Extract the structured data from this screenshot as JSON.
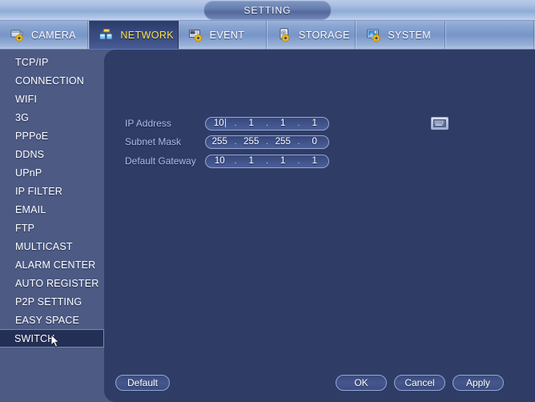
{
  "window": {
    "title": "SETTING"
  },
  "tabs": [
    {
      "label": "CAMERA",
      "icon": "camera-gear-icon",
      "active": false
    },
    {
      "label": "NETWORK",
      "icon": "network-gear-icon",
      "active": true
    },
    {
      "label": "EVENT",
      "icon": "event-gear-icon",
      "active": false
    },
    {
      "label": "STORAGE",
      "icon": "storage-gear-icon",
      "active": false
    },
    {
      "label": "SYSTEM",
      "icon": "system-gear-icon",
      "active": false
    }
  ],
  "sidebar": {
    "items": [
      {
        "label": "TCP/IP",
        "selected": false
      },
      {
        "label": "CONNECTION",
        "selected": false
      },
      {
        "label": "WIFI",
        "selected": false
      },
      {
        "label": "3G",
        "selected": false
      },
      {
        "label": "PPPoE",
        "selected": false
      },
      {
        "label": "DDNS",
        "selected": false
      },
      {
        "label": "UPnP",
        "selected": false
      },
      {
        "label": "IP FILTER",
        "selected": false
      },
      {
        "label": "EMAIL",
        "selected": false
      },
      {
        "label": "FTP",
        "selected": false
      },
      {
        "label": "MULTICAST",
        "selected": false
      },
      {
        "label": "ALARM CENTER",
        "selected": false
      },
      {
        "label": "AUTO REGISTER",
        "selected": false
      },
      {
        "label": "P2P SETTING",
        "selected": false
      },
      {
        "label": "EASY SPACE",
        "selected": false
      },
      {
        "label": "SWITCH",
        "selected": true
      }
    ]
  },
  "form": {
    "rows": [
      {
        "label": "IP Address",
        "octets": [
          "10",
          "1",
          "1",
          "1"
        ],
        "caret_after_octet": 0,
        "has_keypad": true
      },
      {
        "label": "Subnet Mask",
        "octets": [
          "255",
          "255",
          "255",
          "0"
        ],
        "caret_after_octet": -1,
        "has_keypad": false
      },
      {
        "label": "Default Gateway",
        "octets": [
          "10",
          "1",
          "1",
          "1"
        ],
        "caret_after_octet": -1,
        "has_keypad": false
      }
    ],
    "separator": ".",
    "keypad_icon": "keyboard-icon"
  },
  "buttons": {
    "default": "Default",
    "ok": "OK",
    "cancel": "Cancel",
    "apply": "Apply"
  },
  "colors": {
    "accent_active_tab_text": "#ffe44d",
    "titlebar": "#a9bfe2",
    "sidebar_bg": "#4c5a84",
    "content_bg": "#2f3c66",
    "selected_item_bg": "#242f55",
    "field_label": "#a8bcea",
    "caret": "#ffe44d"
  }
}
